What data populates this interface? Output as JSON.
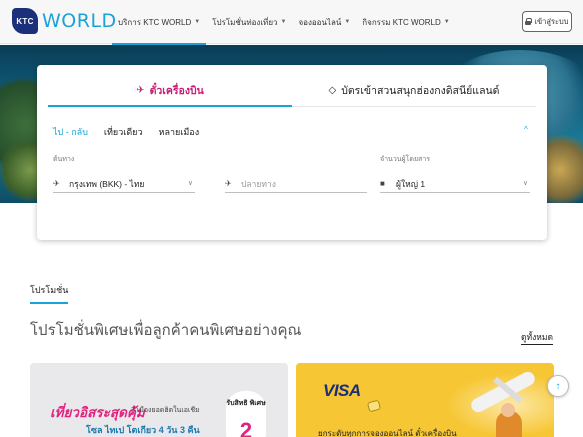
{
  "header": {
    "logo_badge": "KTC",
    "logo_word": "WORLD",
    "nav": [
      {
        "label": "บริการ KTC WORLD",
        "active": true
      },
      {
        "label": "โปรโมชั่นท่องเที่ยว",
        "active": false
      },
      {
        "label": "จองออนไลน์",
        "active": false
      },
      {
        "label": "กิจกรรม KTC WORLD",
        "active": false
      }
    ],
    "login_label": "เข้าสู่ระบบ"
  },
  "search": {
    "tabs": [
      {
        "label": "ตั๋วเครื่องบิน",
        "icon": "plane-ticket-icon",
        "active": true
      },
      {
        "label": "บัตรเข้าสวนสนุกฮ่องกงดิสนีย์แลนด์",
        "icon": "ticket-icon",
        "active": false
      }
    ],
    "trip_types": [
      {
        "label": "ไป - กลับ",
        "active": true
      },
      {
        "label": "เที่ยวเดียว",
        "active": false
      },
      {
        "label": "หลายเมือง",
        "active": false
      }
    ],
    "origin_label": "ต้นทาง",
    "origin_value": "กรุงเทพ (BKK) - ไทย",
    "destination_placeholder": "ปลายทาง",
    "passengers_label": "จำนวนผู้โดยสาร",
    "passengers_value": "ผู้ใหญ่ 1"
  },
  "promotions": {
    "tab_label": "โปรโมชั่น",
    "title": "โปรโมชั่นพิเศษเพื่อลูกค้าคนพิเศษอย่างคุณ",
    "see_all": "ดูทั้งหมด",
    "banner1": {
      "headline": "เที่ยวอิสระสุดคุ้ม",
      "sub": "3 เมืองยอดฮิตในเอเชีย",
      "line2": "โซล ไทเป โตเกียว 4 วัน 3 คืน",
      "badge_text": "รับสิทธิ พิเศษ",
      "badge_num": "2"
    },
    "banner2": {
      "brand": "VISA",
      "text": "ยกระดับทุกการจองออนไลน์ ตั๋วเครื่องบิน"
    }
  },
  "colors": {
    "accent": "#19a3d8",
    "brand_pink": "#c71d74",
    "logo_navy": "#1b2f7a"
  }
}
